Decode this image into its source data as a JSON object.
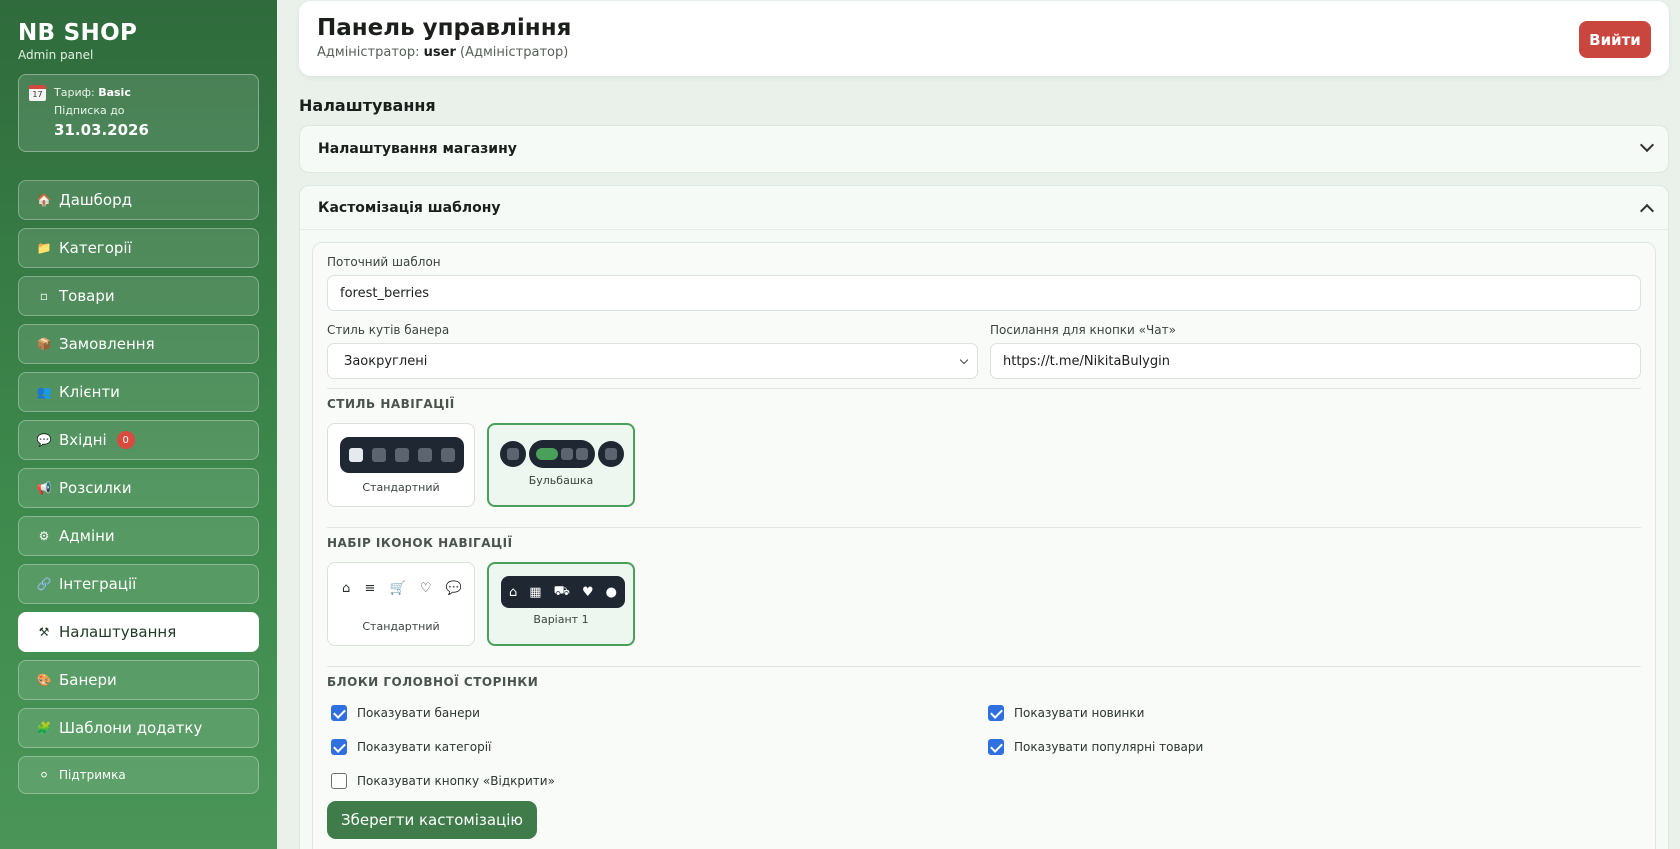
{
  "sidebar": {
    "brand": "NB SHOP",
    "brand_sub": "Admin panel",
    "plan": {
      "tariff_label": "Тариф:",
      "tariff_value": "Basic",
      "sub_label": "Підписка до",
      "sub_date": "31.03.2026"
    },
    "items": [
      {
        "icon": "🏠",
        "label": "Дашборд"
      },
      {
        "icon": "📁",
        "label": "Категорії"
      },
      {
        "icon": "▫",
        "label": "Товари"
      },
      {
        "icon": "📦",
        "label": "Замовлення"
      },
      {
        "icon": "👥",
        "label": "Клієнти"
      },
      {
        "icon": "💬",
        "label": "Вхідні",
        "badge": "0"
      },
      {
        "icon": "📢",
        "label": "Розсилки"
      },
      {
        "icon": "⚙",
        "label": "Адміни"
      },
      {
        "icon": "🔗",
        "label": "Інтеграції"
      },
      {
        "icon": "⚒",
        "label": "Налаштування"
      },
      {
        "icon": "🎨",
        "label": "Банери"
      },
      {
        "icon": "🧩",
        "label": "Шаблони додатку"
      },
      {
        "icon": "⚪",
        "label": "Підтримка"
      }
    ]
  },
  "header": {
    "title": "Панель управління",
    "admin_prefix": "Адміністратор:",
    "admin_user": "user",
    "admin_role": "(Адміністратор)",
    "logout": "Вийти"
  },
  "settings": {
    "title": "Налаштування",
    "store_section": "Налаштування магазину",
    "custom_section": "Кастомізація шаблону",
    "current_template_label": "Поточний шаблон",
    "current_template_value": "forest_berries",
    "banner_corners_label": "Стиль кутів банера",
    "banner_corners_value": "Заокруглені",
    "chat_link_label": "Посилання для кнопки «Чат»",
    "chat_link_value": "https://t.me/NikitaBulygin",
    "nav_style_title": "Стиль навігації",
    "nav_style_options": [
      "Стандартний",
      "Бульбашка"
    ],
    "nav_icons_title": "Набір іконок навігації",
    "nav_icons_options": [
      "Стандартний",
      "Варіант 1"
    ],
    "home_blocks_title": "Блоки головної сторінки",
    "checks": [
      {
        "label": "Показувати банери",
        "checked": true
      },
      {
        "label": "Показувати новинки",
        "checked": true
      },
      {
        "label": "Показувати категорії",
        "checked": true
      },
      {
        "label": "Показувати популярні товари",
        "checked": true
      },
      {
        "label": "Показувати кнопку «Відкрити»",
        "checked": false
      }
    ],
    "save": "Зберегти кастомізацію"
  },
  "colors": {
    "sidebar": "#3e8a4d",
    "accent": "#4aa05a",
    "danger": "#c9463f",
    "checkbox": "#2f6fe0"
  }
}
